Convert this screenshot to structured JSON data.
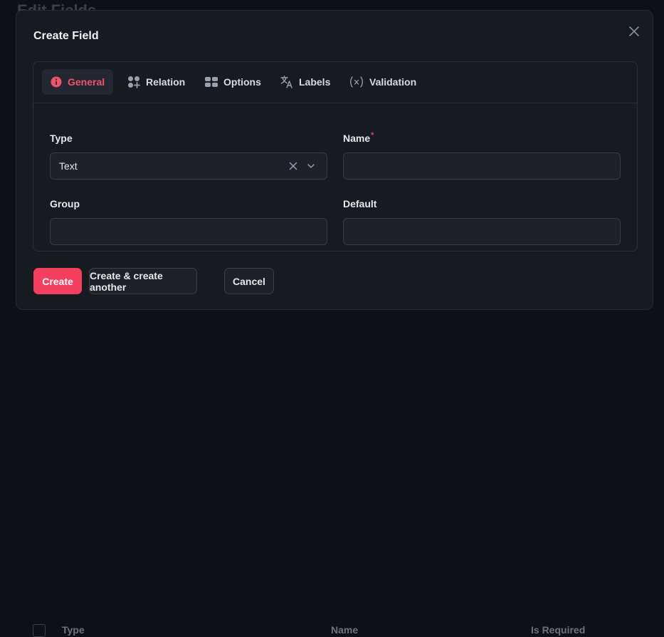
{
  "background": {
    "page_title": "Edit Fields",
    "table_columns": [
      "Type",
      "Name",
      "Is Required"
    ]
  },
  "modal": {
    "title": "Create Field",
    "tabs": [
      {
        "label": "General",
        "icon": "info-icon",
        "active": true
      },
      {
        "label": "Relation",
        "icon": "relation-icon",
        "active": false
      },
      {
        "label": "Options",
        "icon": "options-icon",
        "active": false
      },
      {
        "label": "Labels",
        "icon": "translate-icon",
        "active": false
      },
      {
        "label": "Validation",
        "icon": "function-icon",
        "active": false
      }
    ],
    "form": {
      "type_label": "Type",
      "type_value": "Text",
      "name_label": "Name",
      "name_required_mark": "*",
      "name_value": "",
      "group_label": "Group",
      "group_value": "",
      "default_label": "Default",
      "default_value": ""
    },
    "buttons": {
      "create": "Create",
      "create_another": "Create & create another",
      "cancel": "Cancel"
    }
  },
  "colors": {
    "accent": "#f43f5e",
    "background": "#0d1117",
    "modal": "#161b22",
    "input": "#1c212a"
  }
}
